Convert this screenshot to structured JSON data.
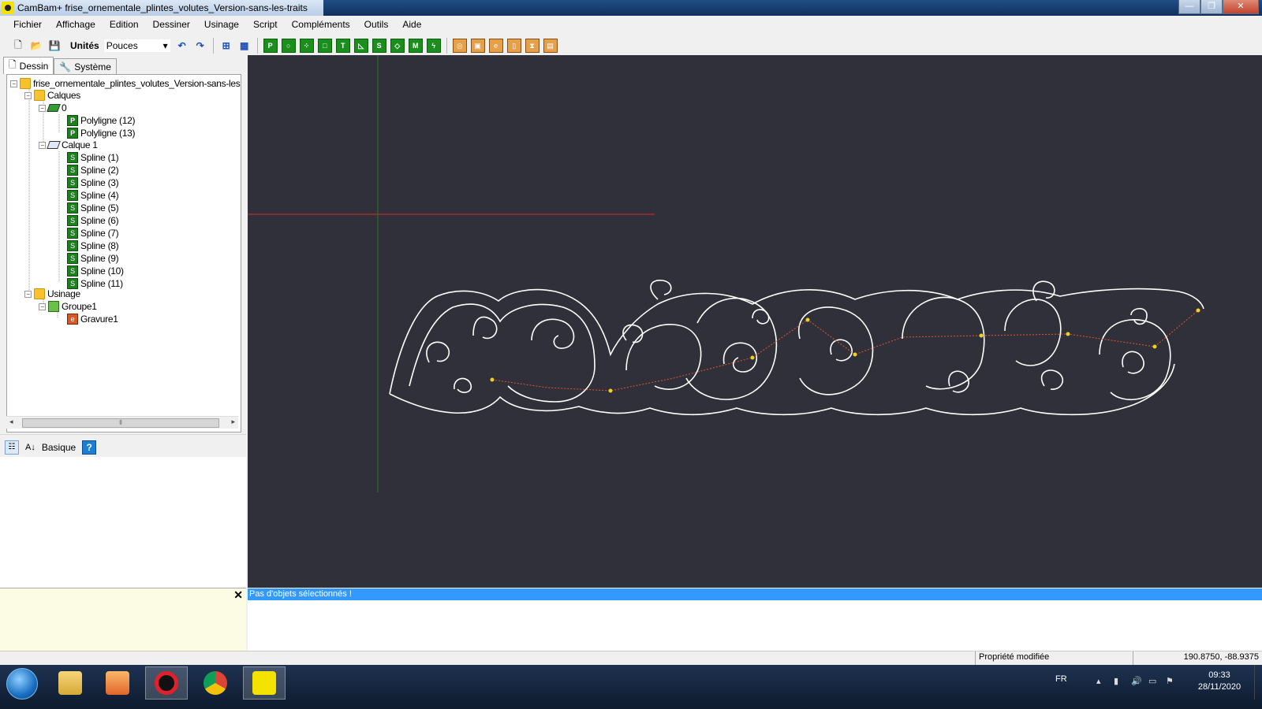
{
  "window": {
    "title": "CamBam+  frise_ornementale_plintes_volutes_Version-sans-les-traits",
    "buttons": [
      "—",
      "❐",
      "✕"
    ]
  },
  "menu": [
    "Fichier",
    "Affichage",
    "Edition",
    "Dessiner",
    "Usinage",
    "Script",
    "Compléments",
    "Outils",
    "Aide"
  ],
  "toolbar": {
    "units_label": "Unités",
    "units_value": "Pouces"
  },
  "left_tabs": [
    "Dessin",
    "Système"
  ],
  "tree": {
    "root": "frise_ornementale_plintes_volutes_Version-sans-les-traits",
    "calques_label": "Calques",
    "layer0_label": "0",
    "layer0_items": [
      "Polyligne (12)",
      "Polyligne (13)"
    ],
    "layer1_label": "Calque 1",
    "layer1_items": [
      "Spline (1)",
      "Spline (2)",
      "Spline (3)",
      "Spline (4)",
      "Spline (5)",
      "Spline (6)",
      "Spline (7)",
      "Spline (8)",
      "Spline (9)",
      "Spline (10)",
      "Spline (11)"
    ],
    "usinage_label": "Usinage",
    "group_label": "Groupe1",
    "operation_label": "Gravure1"
  },
  "properties": {
    "mode_label": "Basique",
    "help": "?"
  },
  "message": {
    "selection_status": "Pas d'objets sélectionnés !",
    "close": "✕"
  },
  "statusbar": {
    "message": "Propriété modifiée",
    "coordinates": "190.8750, -88.9375"
  },
  "taskbar": {
    "language": "FR",
    "time": "09:33",
    "date": "28/11/2020"
  },
  "colors": {
    "canvas_background": "#30303a",
    "shape_stroke": "#ffffff",
    "toolpath": "#e0562a",
    "x_axis": "#c0282a",
    "y_axis": "#1f7a1f",
    "selection_bar": "#3399ff"
  }
}
